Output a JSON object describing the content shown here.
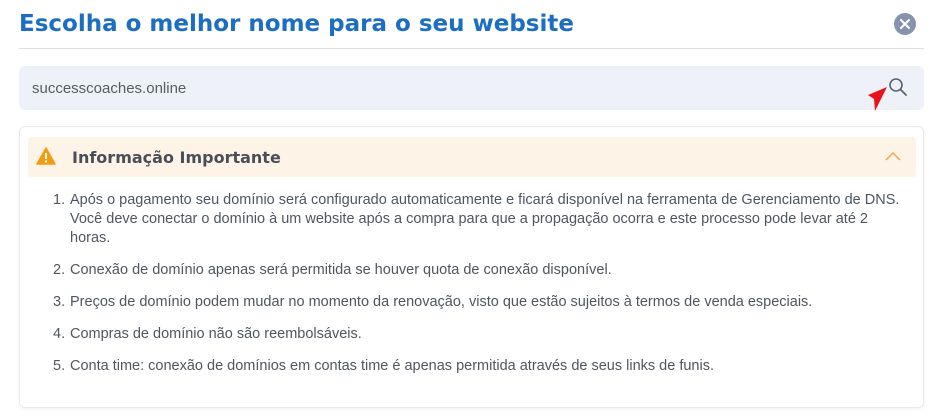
{
  "header": {
    "title": "Escolha o melhor nome para o seu website"
  },
  "search": {
    "value": "successcoaches.online"
  },
  "info": {
    "title": "Informação Importante",
    "items": [
      {
        "number": "1.",
        "text": "Após o pagamento seu domínio será configurado automaticamente e ficará disponível na ferramenta de Gerenciamento de DNS. Você deve conectar o domínio à um website após a compra para que a propagação ocorra e este processo pode levar até 2 horas."
      },
      {
        "number": "2.",
        "text": "Conexão de domínio apenas será permitida se houver quota de conexão disponível."
      },
      {
        "number": "3.",
        "text": "Preços de domínio podem mudar no momento da renovação, visto que estão sujeitos à termos de venda especiais."
      },
      {
        "number": "4.",
        "text": "Compras de domínio não são reembolsáveis."
      },
      {
        "number": "5.",
        "text": "Conta time: conexão de domínios em contas time é apenas permitida através de seus links de funis."
      }
    ]
  },
  "icons": {
    "close": "close-icon",
    "search": "search-icon",
    "warning": "warning-icon",
    "collapse": "chevron-up-icon",
    "cursor": "cursor-arrow-icon"
  },
  "colors": {
    "title": "#1b6ec2",
    "close_bg": "#8593ab",
    "search_bg": "#eef1f7",
    "info_header_bg": "#fdf3e6",
    "warning": "#f39c12",
    "cursor": "#e8121c"
  }
}
